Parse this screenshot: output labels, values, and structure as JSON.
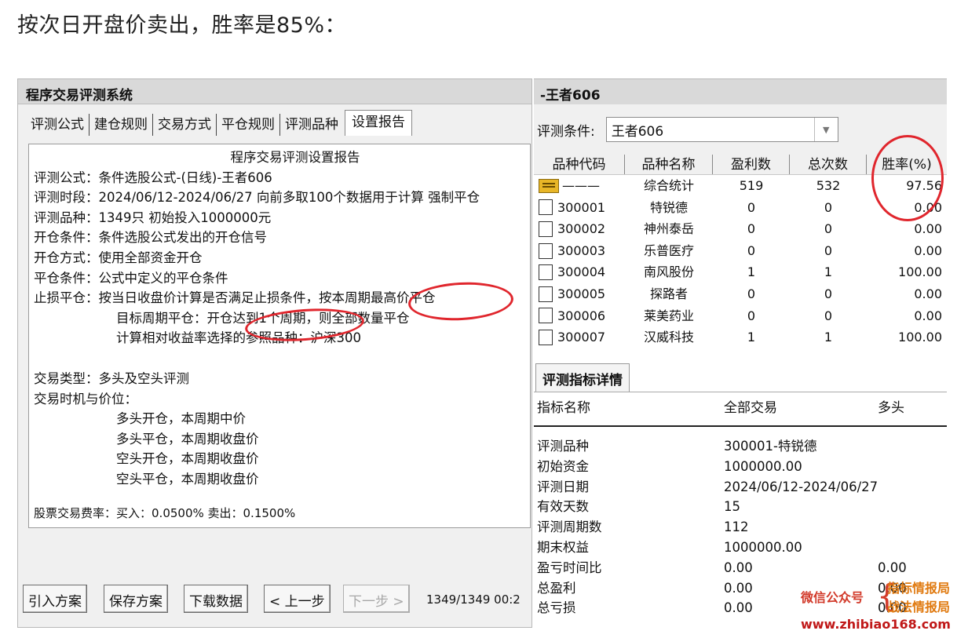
{
  "headline": "按次日开盘价卖出，胜率是85%：",
  "left_window": {
    "title": "程序交易评测系统",
    "tabs": [
      "评测公式",
      "建仓规则",
      "交易方式",
      "平仓规则",
      "评测品种",
      "设置报告"
    ],
    "report": {
      "title": "程序交易评测设置报告",
      "lines": [
        "评测公式：条件选股公式-(日线)-王者606",
        "评测时段：2024/06/12-2024/06/27 向前多取100个数据用于计算 强制平仓",
        "评测品种：1349只 初始投入1000000元",
        "开仓条件：条件选股公式发出的开仓信号",
        "开仓方式：使用全部资金开仓",
        "平仓条件：公式中定义的平仓条件",
        "止损平仓：按当日收盘价计算是否满足止损条件，按本周期最高价平仓"
      ],
      "indent_lines": [
        "目标周期平仓：开仓达到1个周期，则全部数量平仓",
        "计算相对收益率选择的参照品种：沪深300"
      ],
      "lines2": [
        "交易类型：多头及空头评测",
        "交易时机与价位："
      ],
      "timing_lines": [
        "多头开仓，本周期中价",
        "多头平仓，本周期收盘价",
        "空头开仓，本周期收盘价",
        "空头平仓，本周期收盘价"
      ],
      "fee_line": "股票交易费率：买入：0.0500% 卖出：0.1500%"
    },
    "buttons": {
      "import": "引入方案",
      "save": "保存方案",
      "download": "下载数据",
      "prev": "< 上一步",
      "next": "下一步 >"
    },
    "progress": "1349/1349 00:2"
  },
  "right_window": {
    "title": "-王者606",
    "condition_label": "评测条件:",
    "condition_value": "王者606",
    "grid_headers": [
      "品种代码",
      "品种名称",
      "盈利数",
      "总次数",
      "胜率(%)"
    ],
    "grid_rows": [
      {
        "code": "———",
        "name": "综合统计",
        "win": "519",
        "total": "532",
        "rate": "97.56",
        "icon": "folder"
      },
      {
        "code": "300001",
        "name": "特锐德",
        "win": "0",
        "total": "0",
        "rate": "0.00",
        "icon": "doc"
      },
      {
        "code": "300002",
        "name": "神州泰岳",
        "win": "0",
        "total": "0",
        "rate": "0.00",
        "icon": "doc"
      },
      {
        "code": "300003",
        "name": "乐普医疗",
        "win": "0",
        "total": "0",
        "rate": "0.00",
        "icon": "doc"
      },
      {
        "code": "300004",
        "name": "南风股份",
        "win": "1",
        "total": "1",
        "rate": "100.00",
        "icon": "doc"
      },
      {
        "code": "300005",
        "name": "探路者",
        "win": "0",
        "total": "0",
        "rate": "0.00",
        "icon": "doc"
      },
      {
        "code": "300006",
        "name": "莱美药业",
        "win": "0",
        "total": "0",
        "rate": "0.00",
        "icon": "doc"
      },
      {
        "code": "300007",
        "name": "汉威科技",
        "win": "1",
        "total": "1",
        "rate": "100.00",
        "icon": "doc"
      }
    ],
    "detail_tab": "评测指标详情",
    "detail_headers": [
      "指标名称",
      "全部交易",
      "多头"
    ],
    "detail_rows": [
      {
        "name": "评测品种",
        "all": "300001-特锐德",
        "long": ""
      },
      {
        "name": "初始资金",
        "all": "1000000.00",
        "long": ""
      },
      {
        "name": "评测日期",
        "all": "2024/06/12-2024/06/27",
        "long": ""
      },
      {
        "name": "有效天数",
        "all": "15",
        "long": ""
      },
      {
        "name": "评测周期数",
        "all": "112",
        "long": ""
      },
      {
        "name": "期末权益",
        "all": "1000000.00",
        "long": ""
      },
      {
        "name": "盈亏时间比",
        "all": "0.00",
        "long": "0.00"
      },
      {
        "name": "总盈利",
        "all": "0.00",
        "long": "0.00"
      },
      {
        "name": "总亏损",
        "all": "0.00",
        "long": "0.00"
      }
    ]
  },
  "watermark": {
    "left": "微信公众号",
    "right_top": "指标情报局",
    "right_bottom": "战法情报局",
    "url": "www.zhibiao168.com"
  },
  "colors": {
    "annotation": "#e0262d",
    "window_bg": "#f0f0f0",
    "titlebar": "#d9d9d9"
  }
}
